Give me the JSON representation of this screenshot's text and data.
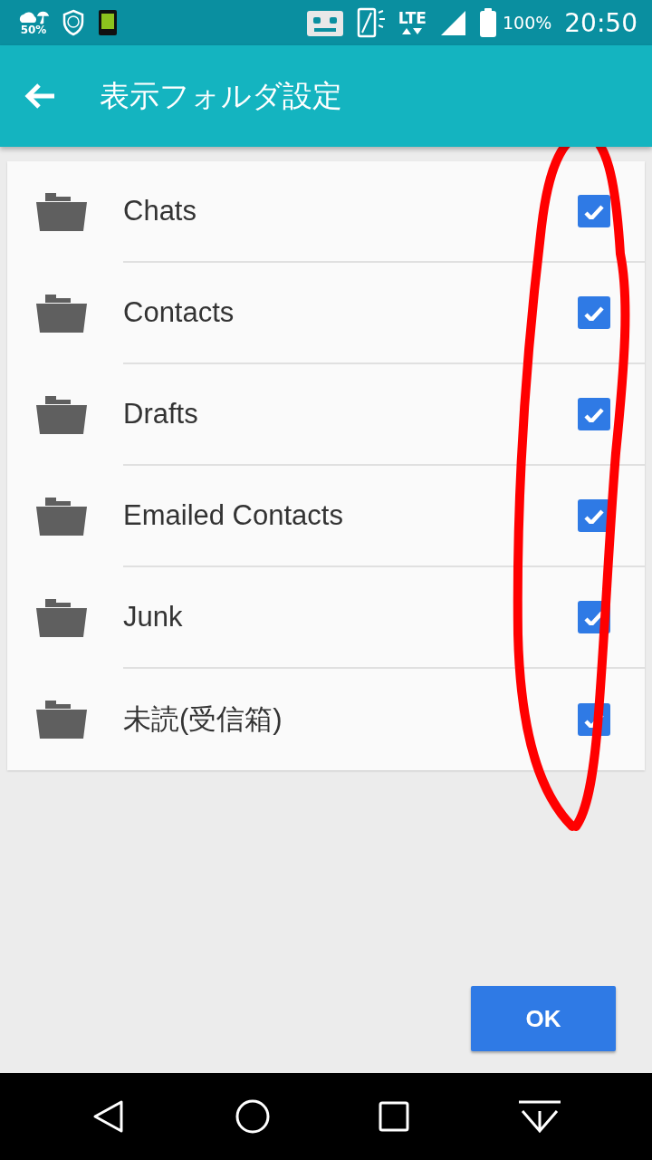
{
  "status_bar": {
    "weather": "50%",
    "network": "LTE",
    "battery": "100%",
    "time": "20:50"
  },
  "app_bar": {
    "title": "表示フォルダ設定"
  },
  "folders": [
    {
      "name": "Chats",
      "checked": true
    },
    {
      "name": "Contacts",
      "checked": true
    },
    {
      "name": "Drafts",
      "checked": true
    },
    {
      "name": "Emailed Contacts",
      "checked": true
    },
    {
      "name": "Junk",
      "checked": true
    },
    {
      "name": "未読(受信箱)",
      "checked": true
    }
  ],
  "ok_button": "OK"
}
